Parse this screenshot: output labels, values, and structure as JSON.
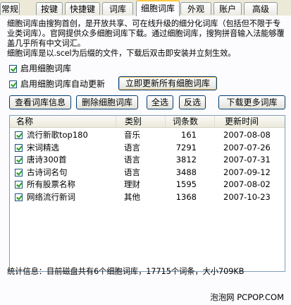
{
  "tabs": [
    "常规",
    "按键",
    "快捷键",
    "词库",
    "细胞词库",
    "外观",
    "账户",
    "高级"
  ],
  "active_tab": "细胞词库",
  "description": {
    "para1": "细胞词库由搜狗首创，是开放共享、可在线升级的细分化词库（包括但不限于专业类词库）。官网提供众多细胞词库下载。通过细胞词库，搜狗拼音输入法能够覆盖几乎所有中文词汇。",
    "para2": "细胞词库是以.scel为后缀的文件，下载后双击即安装并立刻生效。"
  },
  "options": {
    "enable_label": "启用细胞词库",
    "enable_checked": true,
    "auto_update_label": "启用细胞词库自动更新",
    "auto_update_checked": true,
    "update_now_label": "立即更新所有细胞词库"
  },
  "toolbar": {
    "view_info": "查看词库信息",
    "delete": "删除细胞词库",
    "select_all": "全选",
    "invert": "反选",
    "download_more": "下载更多词库"
  },
  "table": {
    "headers": [
      "名称",
      "类别",
      "词条数",
      "更新时间"
    ],
    "rows": [
      {
        "checked": true,
        "name": "流行新歌top180",
        "category": "音乐",
        "count": "161",
        "date": "2007-08-08"
      },
      {
        "checked": true,
        "name": "宋词精选",
        "category": "语言",
        "count": "7291",
        "date": "2007-07-26"
      },
      {
        "checked": true,
        "name": "唐诗300首",
        "category": "语言",
        "count": "3812",
        "date": "2007-07-31"
      },
      {
        "checked": true,
        "name": "古诗词名句",
        "category": "语言",
        "count": "3488",
        "date": "2007-09-12"
      },
      {
        "checked": true,
        "name": "所有股票名称",
        "category": "理财",
        "count": "1595",
        "date": "2007-08-02"
      },
      {
        "checked": true,
        "name": "网络流行新词",
        "category": "其他",
        "count": "1368",
        "date": "2007-10-23"
      }
    ]
  },
  "status": "统计信息：目前磁盘共有6个细胞词库，17715个词条，大小709KB",
  "watermark": "泡泡网 PCPOP.COM"
}
